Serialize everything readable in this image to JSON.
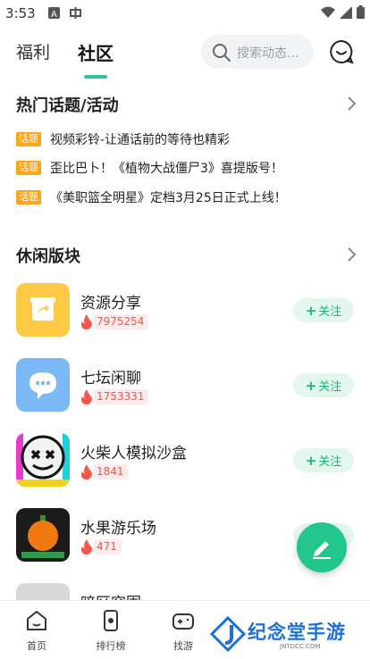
{
  "status_bar": {
    "time": "3:53"
  },
  "header": {
    "tabs": [
      {
        "label": "福利"
      },
      {
        "label": "社区"
      }
    ],
    "active_tab": "社区",
    "search": {
      "placeholder": "搜索动态..."
    }
  },
  "hot_topics": {
    "title": "热门话题/活动",
    "items": [
      {
        "tag": "话题",
        "text": "视频彩铃-让通话前的等待也精彩"
      },
      {
        "tag": "话题",
        "text": "歪比巴卜！《植物大战僵尸3》喜提版号！"
      },
      {
        "tag": "话题",
        "text": "《美职篮全明星》定档3月25日正式上线！"
      }
    ]
  },
  "leisure": {
    "title": "休闲版块",
    "items": [
      {
        "name": "资源分享",
        "heat": "7975254",
        "follow": "关注",
        "icon": "share-box-icon"
      },
      {
        "name": "七坛闲聊",
        "heat": "1753331",
        "follow": "关注",
        "icon": "chat-bubble-icon"
      },
      {
        "name": "火柴人模拟沙盒",
        "heat": "1841",
        "follow": "关注",
        "icon": "game-face-icon"
      },
      {
        "name": "水果游乐场",
        "heat": "471",
        "follow": "关注",
        "icon": "fruit-game-icon"
      },
      {
        "name": "暗区突围"
      }
    ]
  },
  "bottom_nav": [
    {
      "label": "首页",
      "icon": "home-icon"
    },
    {
      "label": "排行榜",
      "icon": "ranking-icon"
    },
    {
      "label": "找游",
      "icon": "gamepad-icon"
    }
  ],
  "watermark": {
    "text": "纪念堂手游",
    "sub": "JNTDCC.COM"
  },
  "colors": {
    "accent": "#2ec98e",
    "tag": "#ffa41b",
    "heat": "#f4564b"
  }
}
